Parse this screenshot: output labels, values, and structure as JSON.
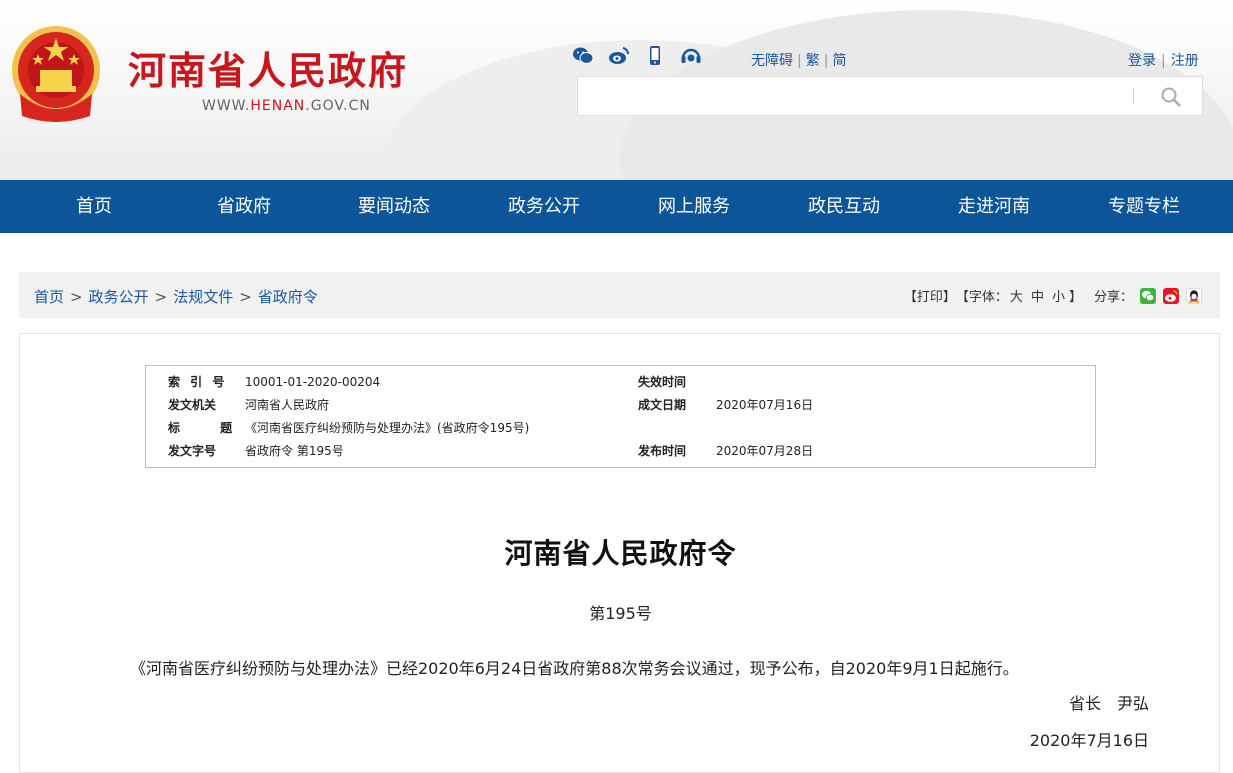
{
  "header": {
    "site_title": "河南省人民政府",
    "site_url_prefix": "WWW.",
    "site_url_highlight": "HENAN",
    "site_url_suffix": ".GOV.CN",
    "accessibility": "无障碍",
    "traditional": "繁",
    "simplified": "简",
    "login": "登录",
    "register": "注册",
    "search_placeholder": ""
  },
  "nav": {
    "items": [
      "首页",
      "省政府",
      "要闻动态",
      "政务公开",
      "网上服务",
      "政民互动",
      "走进河南",
      "专题专栏"
    ]
  },
  "breadcrumb": {
    "items": [
      "首页",
      "政务公开",
      "法规文件",
      "省政府令"
    ],
    "separator": ">"
  },
  "tools": {
    "print": "【打印】",
    "font_label": "【字体：",
    "font_large": "大",
    "font_medium": "中",
    "font_small": "小",
    "font_close": "】",
    "share_label": "分享："
  },
  "meta": {
    "index_label": "索 引 号",
    "index_value": "10001-01-2020-00204",
    "expire_label": "失效时间",
    "expire_value": "",
    "issuer_label": "发文机关",
    "issuer_value": "河南省人民政府",
    "created_label": "成文日期",
    "created_value": "2020年07月16日",
    "title_label": "标 题",
    "title_value": "《河南省医疗纠纷预防与处理办法》(省政府令195号)",
    "docno_label": "发文字号",
    "docno_value": "省政府令 第195号",
    "publish_label": "发布时间",
    "publish_value": "2020年07月28日"
  },
  "document": {
    "title": "河南省人民政府令",
    "number": "第195号",
    "body": "《河南省医疗纠纷预防与处理办法》已经2020年6月24日省政府第88次常务会议通过，现予公布，自2020年9月1日起施行。",
    "signature": "省长　尹弘",
    "date": "2020年7月16日"
  },
  "colors": {
    "brand_red": "#c8161d",
    "nav_blue": "#0d5599",
    "link_blue": "#1a57a0"
  },
  "icons": [
    "wechat-icon",
    "weibo-icon",
    "mobile-icon",
    "service-icon",
    "search-icon",
    "share-wechat-icon",
    "share-weibo-icon",
    "share-qq-icon"
  ]
}
